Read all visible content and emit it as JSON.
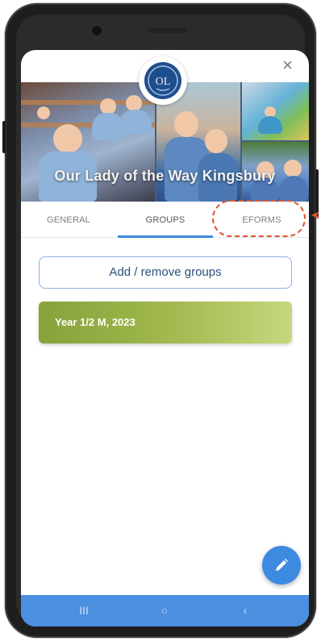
{
  "screen": {
    "close_symbol": "×",
    "banner": {
      "title": "Our Lady of the Way Kingsbury"
    },
    "tabs": [
      {
        "label": "GENERAL",
        "active": false
      },
      {
        "label": "GROUPS",
        "active": true
      },
      {
        "label": "EFORMS",
        "active": false,
        "highlighted": true
      }
    ],
    "add_groups_label": "Add / remove groups",
    "groups": [
      {
        "name": "Year 1/2 M, 2023"
      }
    ],
    "nav": {
      "recent": "III",
      "home": "○",
      "back": "‹"
    }
  },
  "colors": {
    "accent": "#3d8be0",
    "group_card_start": "#86a23a",
    "group_card_end": "#c3d87e",
    "highlight": "#e0542f"
  },
  "icons": {
    "close": "close-icon",
    "logo": "school-logo-icon",
    "edit": "pencil-icon",
    "annotation": "arrow-icon"
  }
}
